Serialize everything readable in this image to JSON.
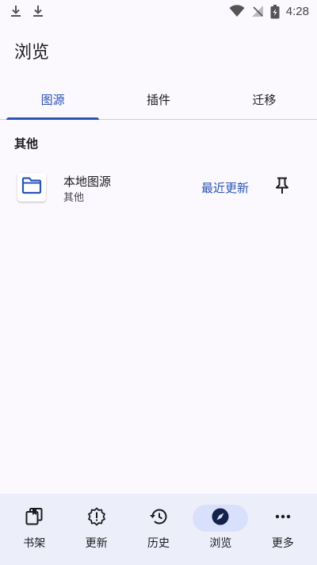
{
  "status_bar": {
    "time": "4:28",
    "icons": [
      "download-icon",
      "download-icon",
      "wifi-icon",
      "no-signal-icon",
      "battery-charging-icon"
    ]
  },
  "header": {
    "title": "浏览"
  },
  "tabs": [
    {
      "label": "图源",
      "active": true
    },
    {
      "label": "插件",
      "active": false
    },
    {
      "label": "迁移",
      "active": false
    }
  ],
  "sources": {
    "section_title": "其他",
    "items": [
      {
        "name": "本地图源",
        "language": "其他",
        "latest_label": "最近更新",
        "icon": "folder-icon"
      }
    ]
  },
  "bottom_nav": [
    {
      "label": "书架",
      "icon": "library-icon",
      "active": false
    },
    {
      "label": "更新",
      "icon": "updates-icon",
      "active": false
    },
    {
      "label": "历史",
      "icon": "history-icon",
      "active": false
    },
    {
      "label": "浏览",
      "icon": "compass-icon",
      "active": true
    },
    {
      "label": "更多",
      "icon": "more-icon",
      "active": false
    }
  ],
  "colors": {
    "accent": "#2a55b5",
    "background": "#fbf8fe",
    "nav_background": "#eceff9",
    "nav_active_pill": "#d8e0fb"
  }
}
